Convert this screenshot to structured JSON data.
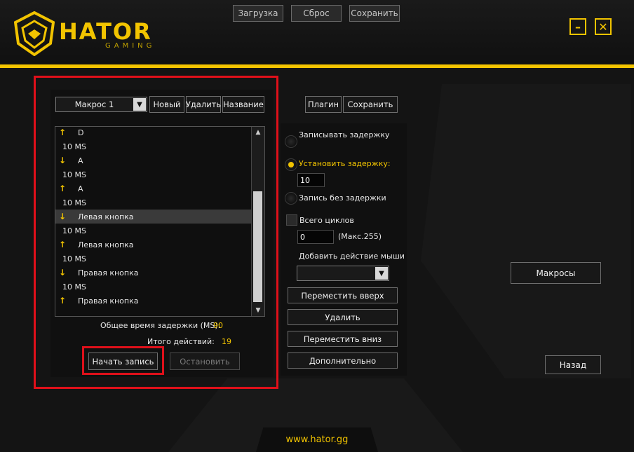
{
  "brand": {
    "name": "HATOR",
    "sub": "GAMING",
    "accent": "#f2c400"
  },
  "top_buttons": {
    "load": "Загрузка",
    "reset": "Сброс",
    "save": "Сохранить"
  },
  "window": {
    "minimize": "–",
    "close": "✕"
  },
  "macro": {
    "selected": "Макрос 1",
    "new_label": "Новый",
    "delete_label": "Удалить",
    "rename_label": "Название",
    "plugin_label": "Плагин",
    "save_label": "Сохранить"
  },
  "events": [
    {
      "dir": "up",
      "text": "D"
    },
    {
      "dir": "delay",
      "text": "10 MS"
    },
    {
      "dir": "down",
      "text": "A"
    },
    {
      "dir": "delay",
      "text": "10 MS"
    },
    {
      "dir": "up",
      "text": "A"
    },
    {
      "dir": "delay",
      "text": "10 MS"
    },
    {
      "dir": "down",
      "text": "Левая кнопка",
      "selected": true
    },
    {
      "dir": "delay",
      "text": "10 MS"
    },
    {
      "dir": "up",
      "text": "Левая кнопка"
    },
    {
      "dir": "delay",
      "text": "10 MS"
    },
    {
      "dir": "down",
      "text": "Правая кнопка"
    },
    {
      "dir": "delay",
      "text": "10 MS"
    },
    {
      "dir": "up",
      "text": "Правая кнопка"
    }
  ],
  "stats": {
    "total_delay_label": "Общее время задержки (MS):",
    "total_delay_value": "90",
    "total_actions_label": "Итого действий:",
    "total_actions_value": "19"
  },
  "record": {
    "start": "Начать запись",
    "stop": "Остановить"
  },
  "delay_options": {
    "record_delay": "Записывать задержку",
    "set_delay": "Установить задержку:",
    "set_delay_value": "10",
    "no_delay": "Запись без задержки",
    "cycles_label": "Всего циклов",
    "cycles_value": "0",
    "cycles_max": "(Макс.255)",
    "mouse_action_label": "Добавить действие мыши",
    "mouse_action_value": ""
  },
  "actions": {
    "move_up": "Переместить вверх",
    "delete": "Удалить",
    "move_down": "Переместить вниз",
    "more": "Дополнительно"
  },
  "nav": {
    "macros": "Макросы",
    "back": "Назад"
  },
  "footer": {
    "url": "www.hator.gg"
  }
}
